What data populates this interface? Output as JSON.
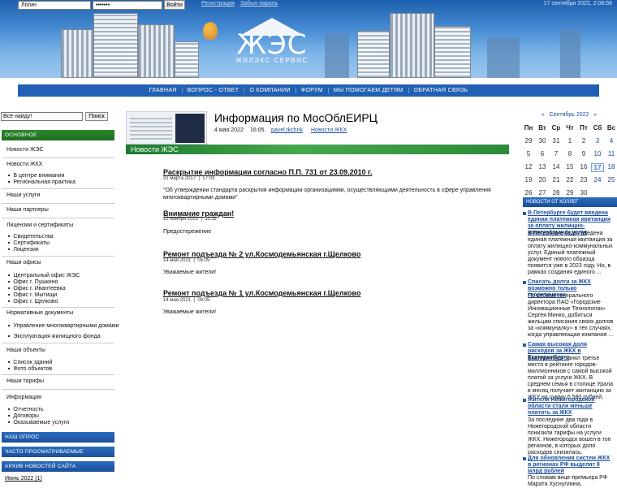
{
  "header": {
    "login_value": "Логин",
    "password_value": "•••••••",
    "login_button": "Войти",
    "register_link": "Регистрация",
    "forgot_link": "Забыл пароль",
    "datetime": "17 сентября 2022, 2:08:56",
    "logo_text": "ЖЭС",
    "logo_subtitle": "ЖИЛЭКС СЕРВИС"
  },
  "nav": [
    "ГЛАВНАЯ",
    "ВОПРОС - ОТВЕТ",
    "О КОМПАНИИ",
    "ФОРУМ",
    "МЫ ПОМОГАЕМ ДЕТЯМ",
    "ОБРАТНАЯ СВЯЗЬ"
  ],
  "search": {
    "value": "Всё найду!",
    "button": "Поиск"
  },
  "sidebar": {
    "main_section": "ОСНОВНОЕ",
    "groups": [
      {
        "title": "Новости ЖЭС",
        "items": []
      },
      {
        "title": "Новости ЖКХ",
        "items": [
          "В центре внимания",
          "Региональная практика"
        ]
      },
      {
        "title": "Наши услуги",
        "items": []
      },
      {
        "title": "Наши партнеры",
        "items": []
      },
      {
        "title": "Лицензии и сертификаты",
        "items": [
          "Свидетельства",
          "Сертификаты",
          "Лицензии"
        ]
      },
      {
        "title": "Наши офисы",
        "items": [
          "Центральный офис ЖЭС",
          "Офис г. Пушкино",
          "Офис г. Ивантеевка",
          "Офис г. Мытищи",
          "Офис г. Щелково"
        ]
      },
      {
        "title": "Нормативные документы",
        "items": [
          "Управление многоквартирными домами",
          "Эксплуатация жилищного фонда"
        ]
      },
      {
        "title": "Наши объекты",
        "items": [
          "Список зданий",
          "Фото объектов"
        ]
      },
      {
        "title": "Наши тарифы",
        "items": []
      },
      {
        "title": "Информация",
        "items": [
          "Отчетность",
          "Договоры",
          "Оказываемые услуги"
        ]
      }
    ],
    "poll_section": "НАШ ОПРОС",
    "popular_section": "ЧАСТО ПРОСМАТРИВАЕМЫЕ",
    "archive_section": "АРХИВ НОВОСТЕЙ САЙТА",
    "archive_items": [
      "Июнь 2022 (1)"
    ]
  },
  "article": {
    "title": "Информация по МосОблЕИРЦ",
    "date": "4 мая 2022",
    "time": "16:05",
    "author": "pavel.tkchnk",
    "category": "Новости ЖКХ"
  },
  "news": {
    "header": "Новости ЖЭС",
    "items": [
      {
        "title": "Раскрытие информации согласно П.П. 731 от 23.09.2010 г.",
        "date": "31 марта 2017",
        "time": "17:03",
        "body": "\"Об утверждении стандарта раскрытия информации организациями, осуществляющими деятельность в сфере управления многоквартирными домами\""
      },
      {
        "title": "Внимание граждан!",
        "date": "12 ноября 2021",
        "time": "11:11",
        "body": "Предостережение"
      },
      {
        "title": "Ремонт подъезда № 2 ул.Космодемьянская г.Щелково",
        "date": "14 мая 2021",
        "time": "09:05",
        "body": "Уважаемые жители!"
      },
      {
        "title": "Ремонт подъезда № 1 ул.Космодемьянская г.Щелково",
        "date": "14 мая 2021",
        "time": "09:05",
        "body": "Уважаемые жители!"
      }
    ]
  },
  "calendar": {
    "prev": "«",
    "month": "Сентябрь 2022",
    "next": "»",
    "dow": [
      "Пн",
      "Вт",
      "Ср",
      "Чт",
      "Пт",
      "Сб",
      "Вс"
    ],
    "weeks": [
      [
        "29",
        "30",
        "31",
        "1",
        "2",
        "3",
        "4"
      ],
      [
        "5",
        "6",
        "7",
        "8",
        "9",
        "10",
        "11"
      ],
      [
        "12",
        "13",
        "14",
        "15",
        "16",
        "17",
        "18"
      ],
      [
        "19",
        "20",
        "21",
        "22",
        "23",
        "24",
        "25"
      ],
      [
        "26",
        "27",
        "28",
        "29",
        "30",
        "",
        ""
      ]
    ],
    "today": "17"
  },
  "partners": {
    "header": "НОВОСТИ ОТ КОЛЛЕГ",
    "items": [
      {
        "title": "В Петербурге будет введена единая платежная квитанция за оплату жилищно-коммунальных услуг",
        "body": "В Петербурге будет введена единая платежная квитанция за оплату жилищно-коммунальных услуг. Единый платежный документ нового образца появится уже в 2023 году. Но, в рамках создания единого ..."
      },
      {
        "title": "Списать долги за ЖКХ возможно только теоретически",
        "body": "По словам генерального директора ПАО «Городские Инновационные Технологии» Сергея Минко, добиться жильцам списания своих долгов за «коммуналку» в тех случаях, когда управляющая компания ..."
      },
      {
        "title": "Самая высокая доля расходов за ЖКХ в Екатеринбурге",
        "body": "Екатеринбург занял третье место в рейтинге городов-миллионников с самой высокой платой за услуги ЖКХ. В среднем семья в столице Урала в месяц получает квитанцию за ЖКУ на сумму 6 580 рублей."
      },
      {
        "title": "Жители Нижегородской области стали меньше платить за ЖКХ",
        "body": "За последние два года в Нижегородской области понизили тарифы на услуги ЖКХ. Нижегородск вошел в топ регионов, в которых доля расходов снизилась."
      },
      {
        "title": "Для обновления систем ЖКХ в регионах РФ выделят 8 млрд рублей",
        "body": "По словам вице-премьера РФ Марата Хуснуллина,"
      }
    ]
  }
}
